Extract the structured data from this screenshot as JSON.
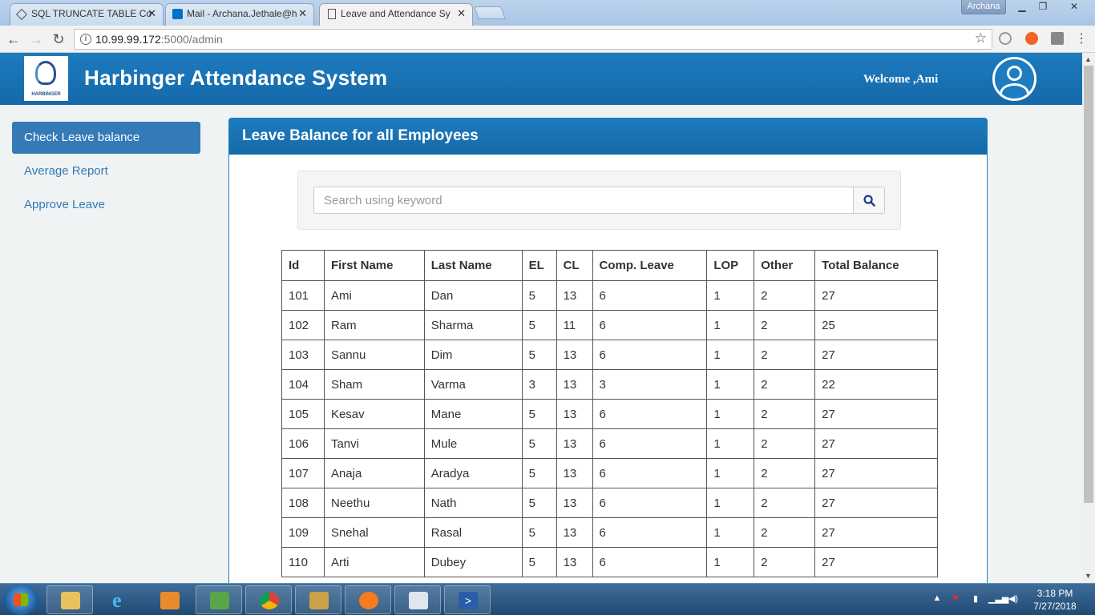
{
  "browser": {
    "tabs": [
      {
        "label": "SQL TRUNCATE TABLE Co",
        "active": false
      },
      {
        "label": "Mail - Archana.Jethale@h",
        "active": false
      },
      {
        "label": "Leave and Attendance Sy",
        "active": true
      }
    ],
    "user_label": "Archana",
    "url_host": "10.99.99.172",
    "url_path": ":5000/admin"
  },
  "header": {
    "logo_text": "HARBINGER",
    "title": "Harbinger Attendance System",
    "welcome": "Welcome ,Ami"
  },
  "sidebar": {
    "items": [
      {
        "label": "Check Leave balance",
        "active": true
      },
      {
        "label": "Average Report",
        "active": false
      },
      {
        "label": "Approve Leave",
        "active": false
      }
    ]
  },
  "panel": {
    "title": "Leave Balance for all Employees",
    "search_placeholder": "Search using keyword"
  },
  "table": {
    "columns": [
      "Id",
      "First Name",
      "Last Name",
      "EL",
      "CL",
      "Comp. Leave",
      "LOP",
      "Other",
      "Total Balance"
    ],
    "rows": [
      [
        "101",
        "Ami",
        "Dan",
        "5",
        "13",
        "6",
        "1",
        "2",
        "27"
      ],
      [
        "102",
        "Ram",
        "Sharma",
        "5",
        "11",
        "6",
        "1",
        "2",
        "25"
      ],
      [
        "103",
        "Sannu",
        "Dim",
        "5",
        "13",
        "6",
        "1",
        "2",
        "27"
      ],
      [
        "104",
        "Sham",
        "Varma",
        "3",
        "13",
        "3",
        "1",
        "2",
        "22"
      ],
      [
        "105",
        "Kesav",
        "Mane",
        "5",
        "13",
        "6",
        "1",
        "2",
        "27"
      ],
      [
        "106",
        "Tanvi",
        "Mule",
        "5",
        "13",
        "6",
        "1",
        "2",
        "27"
      ],
      [
        "107",
        "Anaja",
        "Aradya",
        "5",
        "13",
        "6",
        "1",
        "2",
        "27"
      ],
      [
        "108",
        "Neethu",
        "Nath",
        "5",
        "13",
        "6",
        "1",
        "2",
        "27"
      ],
      [
        "109",
        "Snehal",
        "Rasal",
        "5",
        "13",
        "6",
        "1",
        "2",
        "27"
      ],
      [
        "110",
        "Arti",
        "Dubey",
        "5",
        "13",
        "6",
        "1",
        "2",
        "27"
      ]
    ]
  },
  "taskbar": {
    "time": "3:18 PM",
    "date": "7/27/2018"
  },
  "colors": {
    "brand_blue": "#1d7bbf",
    "sidebar_active": "#337ab7"
  }
}
